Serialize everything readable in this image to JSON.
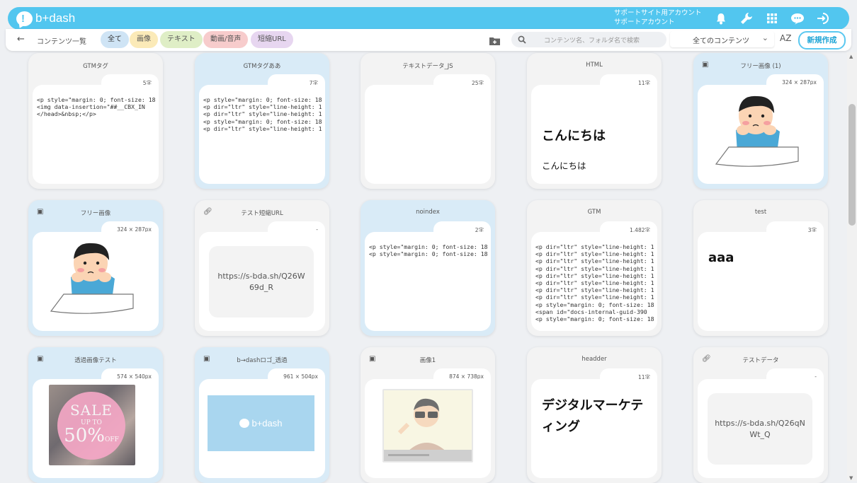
{
  "app": {
    "logo_text": "b+dash"
  },
  "header": {
    "account_line1": "サポートサイト用アカウント",
    "account_line2": "サポートアカウント"
  },
  "toolbar": {
    "breadcrumb": "コンテンツ一覧",
    "filters": [
      "全て",
      "画像",
      "テキスト",
      "動画/音声",
      "短縮URL"
    ],
    "search_placeholder": "コンテンツ名、フォルダ名で検索",
    "select_value": "全てのコンテンツ",
    "sort_label": "AZ",
    "new_button": "新規作成"
  },
  "cards": [
    {
      "title": "GTMタグ",
      "meta": "5字",
      "kind": "code",
      "text": "<p style=\"margin: 0; font-size: 18\n<img data-insertion=\"##__CBX_IN\n</head>&nbsp;</p>"
    },
    {
      "title": "GTMタグああ",
      "meta": "7字",
      "kind": "code",
      "text": "<p style=\"margin: 0; font-size: 18\n<p dir=\"ltr\" style=\"line-height: 1\n<p dir=\"ltr\" style=\"line-height: 1\n<p style=\"margin: 0; font-size: 18\n<p dir=\"ltr\" style=\"line-height: 1"
    },
    {
      "title": "テキストデータ_JS",
      "meta": "25字",
      "kind": "blank",
      "text": ""
    },
    {
      "title": "HTML",
      "meta": "11字",
      "kind": "html",
      "big": "こんにちは",
      "small": "こんにちは"
    },
    {
      "title": "フリー画像 (1)",
      "meta": "324 × 287px",
      "kind": "image"
    },
    {
      "title": "フリー画像",
      "meta": "324 × 287px",
      "kind": "image"
    },
    {
      "title": "テスト短縮URL",
      "meta": "-",
      "kind": "url",
      "url": "https://s-bda.sh/Q26W69d_R"
    },
    {
      "title": "noindex",
      "meta": "2字",
      "kind": "code",
      "text": "<p style=\"margin: 0; font-size: 18\n<p style=\"margin: 0; font-size: 18"
    },
    {
      "title": "GTM",
      "meta": "1,482字",
      "kind": "code",
      "text": "<p dir=\"ltr\" style=\"line-height: 1\n<p dir=\"ltr\" style=\"line-height: 1\n<p dir=\"ltr\" style=\"line-height: 1\n<p dir=\"ltr\" style=\"line-height: 1\n<p dir=\"ltr\" style=\"line-height: 1\n<p dir=\"ltr\" style=\"line-height: 1\n<p dir=\"ltr\" style=\"line-height: 1\n<p dir=\"ltr\" style=\"line-height: 1\n<p style=\"margin: 0; font-size: 18\n<span id=\"docs-internal-guid-390\n<p style=\"margin: 0; font-size: 18"
    },
    {
      "title": "test",
      "meta": "3字",
      "kind": "text",
      "big": "aaa"
    },
    {
      "title": "透過画像テスト",
      "meta": "574 × 540px",
      "kind": "sale",
      "sale1": "SALE",
      "sale2": "UP TO",
      "sale3": "50%",
      "sale4": "OFF"
    },
    {
      "title": "b→dashロゴ_透過",
      "meta": "961 × 504px",
      "kind": "logo",
      "logo": "b+dash"
    },
    {
      "title": "画像1",
      "meta": "874 × 738px",
      "kind": "video"
    },
    {
      "title": "headder",
      "meta": "11字",
      "kind": "text2",
      "big": "デジタルマーケティング"
    },
    {
      "title": "テストデータ",
      "meta": "-",
      "kind": "url",
      "url": "https://s-bda.sh/Q26qNWt_Q"
    }
  ]
}
